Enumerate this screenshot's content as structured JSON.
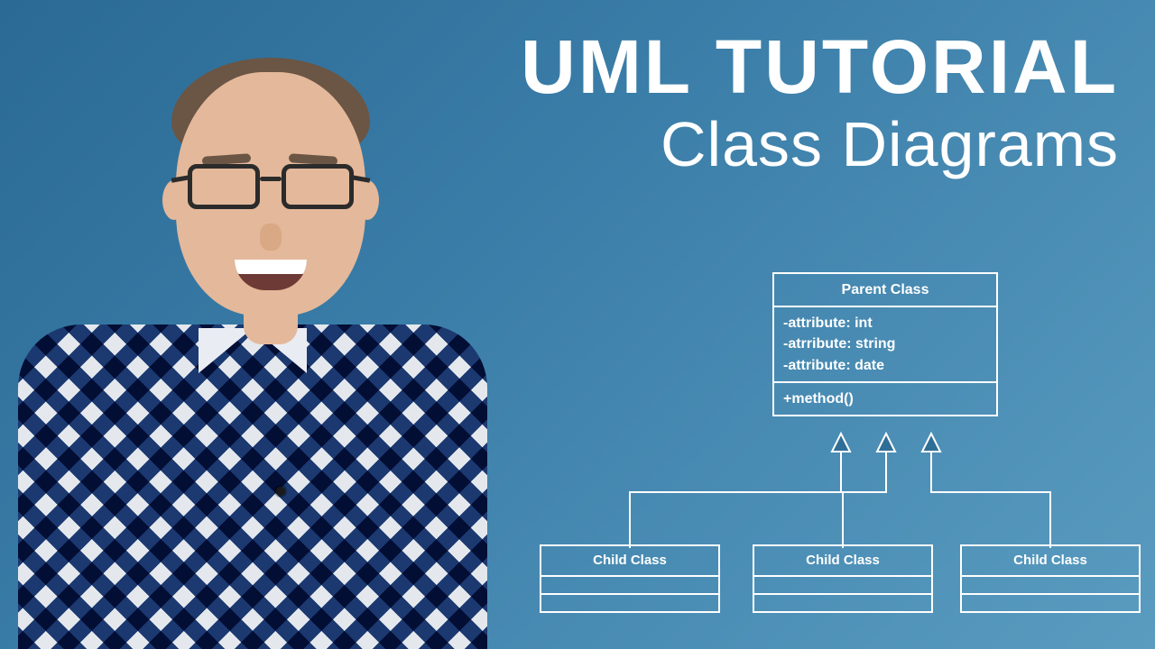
{
  "heading": {
    "title": "UML TUTORIAL",
    "subtitle": "Class Diagrams"
  },
  "diagram": {
    "parent": {
      "name": "Parent Class",
      "attributes": "-attribute: int\n-atrribute: string\n-attribute: date",
      "methods": "+method()"
    },
    "children": [
      {
        "name": "Child Class"
      },
      {
        "name": "Child Class"
      },
      {
        "name": "Child Class"
      }
    ]
  },
  "colors": {
    "text": "#ffffff",
    "line": "#ffffff"
  }
}
